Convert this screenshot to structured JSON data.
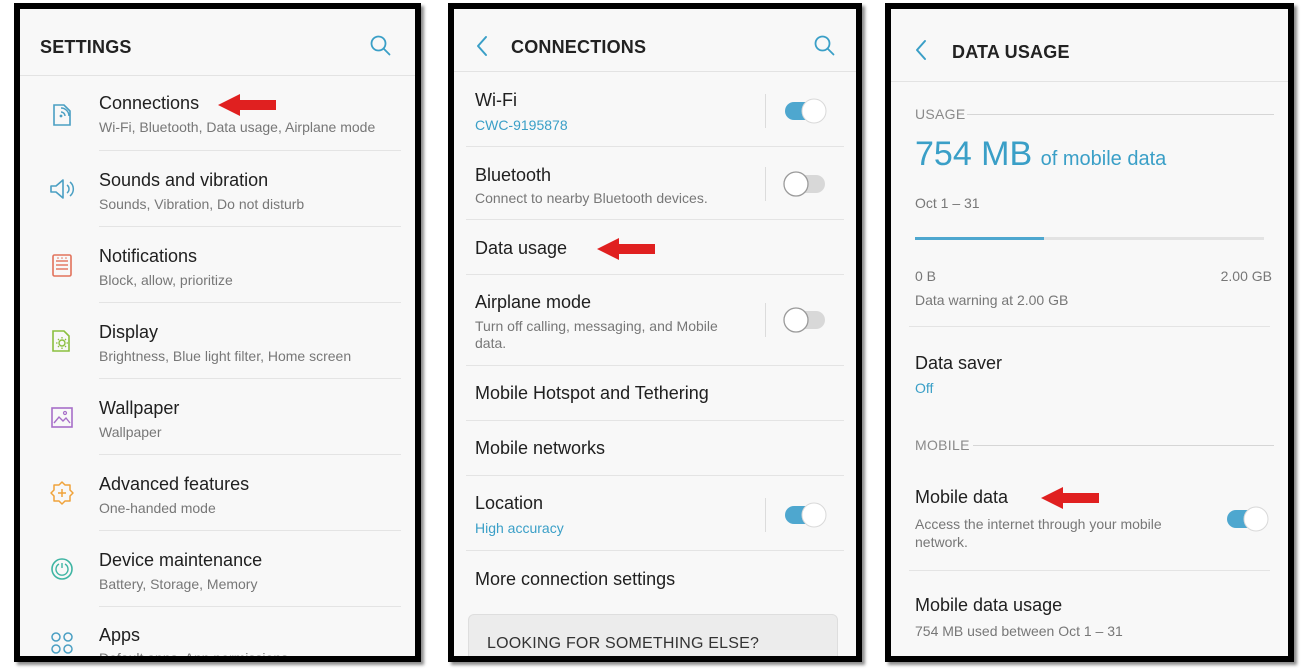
{
  "settings": {
    "title": "SETTINGS",
    "items": [
      {
        "title": "Connections",
        "subtitle": "Wi-Fi, Bluetooth, Data usage, Airplane mode",
        "icon": "connections-icon"
      },
      {
        "title": "Sounds and vibration",
        "subtitle": "Sounds, Vibration, Do not disturb",
        "icon": "speaker-icon"
      },
      {
        "title": "Notifications",
        "subtitle": "Block, allow, prioritize",
        "icon": "notifications-icon"
      },
      {
        "title": "Display",
        "subtitle": "Brightness, Blue light filter, Home screen",
        "icon": "display-icon"
      },
      {
        "title": "Wallpaper",
        "subtitle": "Wallpaper",
        "icon": "wallpaper-icon"
      },
      {
        "title": "Advanced features",
        "subtitle": "One-handed mode",
        "icon": "advanced-features-icon"
      },
      {
        "title": "Device maintenance",
        "subtitle": "Battery, Storage, Memory",
        "icon": "device-maintenance-icon"
      },
      {
        "title": "Apps",
        "subtitle": "Default apps, App permissions",
        "icon": "apps-icon"
      }
    ]
  },
  "connections": {
    "title": "CONNECTIONS",
    "items": [
      {
        "title": "Wi-Fi",
        "subtitle": "CWC-9195878",
        "toggle": true
      },
      {
        "title": "Bluetooth",
        "subtitle": "Connect to nearby Bluetooth devices.",
        "toggle": false
      },
      {
        "title": "Data usage"
      },
      {
        "title": "Airplane mode",
        "subtitle_line1": "Turn off calling, messaging, and Mobile",
        "subtitle_line2": "data.",
        "toggle": false
      },
      {
        "title": "Mobile Hotspot and Tethering"
      },
      {
        "title": "Mobile networks"
      },
      {
        "title": "Location",
        "subtitle": "High accuracy",
        "toggle": true
      },
      {
        "title": "More connection settings"
      }
    ],
    "looking_for": "LOOKING FOR SOMETHING ELSE?"
  },
  "data_usage": {
    "title": "DATA USAGE",
    "usage_section": "USAGE",
    "amount": "754 MB",
    "amount_suffix": "of mobile data",
    "period": "Oct 1 – 31",
    "usage_fraction": 0.37,
    "range_min": "0 B",
    "range_max": "2.00 GB",
    "warning": "Data warning at 2.00 GB",
    "data_saver_title": "Data saver",
    "data_saver_value": "Off",
    "mobile_section": "MOBILE",
    "mobile_data_title": "Mobile data",
    "mobile_data_sub_line1": "Access the internet through your mobile",
    "mobile_data_sub_line2": "network.",
    "mobile_data_toggle": true,
    "mobile_usage_title": "Mobile data usage",
    "mobile_usage_sub": "754 MB used between Oct 1 – 31"
  },
  "colors": {
    "accent": "#3a9fc7",
    "toggle_on": "#4ea7cf",
    "arrow": "#e02020",
    "progress_track": "#e3e3e3"
  }
}
